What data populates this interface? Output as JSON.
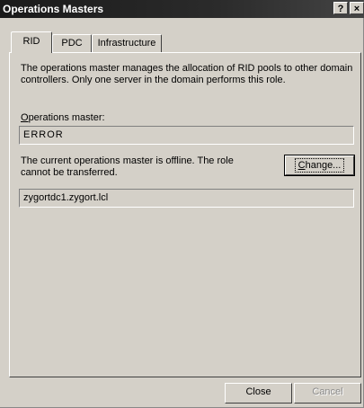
{
  "window": {
    "title": "Operations Masters",
    "help_glyph": "?",
    "close_glyph": "×"
  },
  "tabs": [
    {
      "label": "RID",
      "active": true
    },
    {
      "label": "PDC",
      "active": false
    },
    {
      "label": "Infrastructure",
      "active": false
    }
  ],
  "rid_panel": {
    "description": "The operations master manages the allocation of RID pools to other domain controllers. Only one server in the domain performs this role.",
    "operations_master_label_accel": "O",
    "operations_master_label_rest": "perations master:",
    "operations_master_value": "ERROR",
    "offline_message": "The current operations master is offline. The role cannot be transferred.",
    "change_button_accel": "C",
    "change_button_rest": "hange...",
    "target_server_value": "zygortdc1.zygort.lcl"
  },
  "footer": {
    "close_label": "Close",
    "cancel_label": "Cancel"
  }
}
